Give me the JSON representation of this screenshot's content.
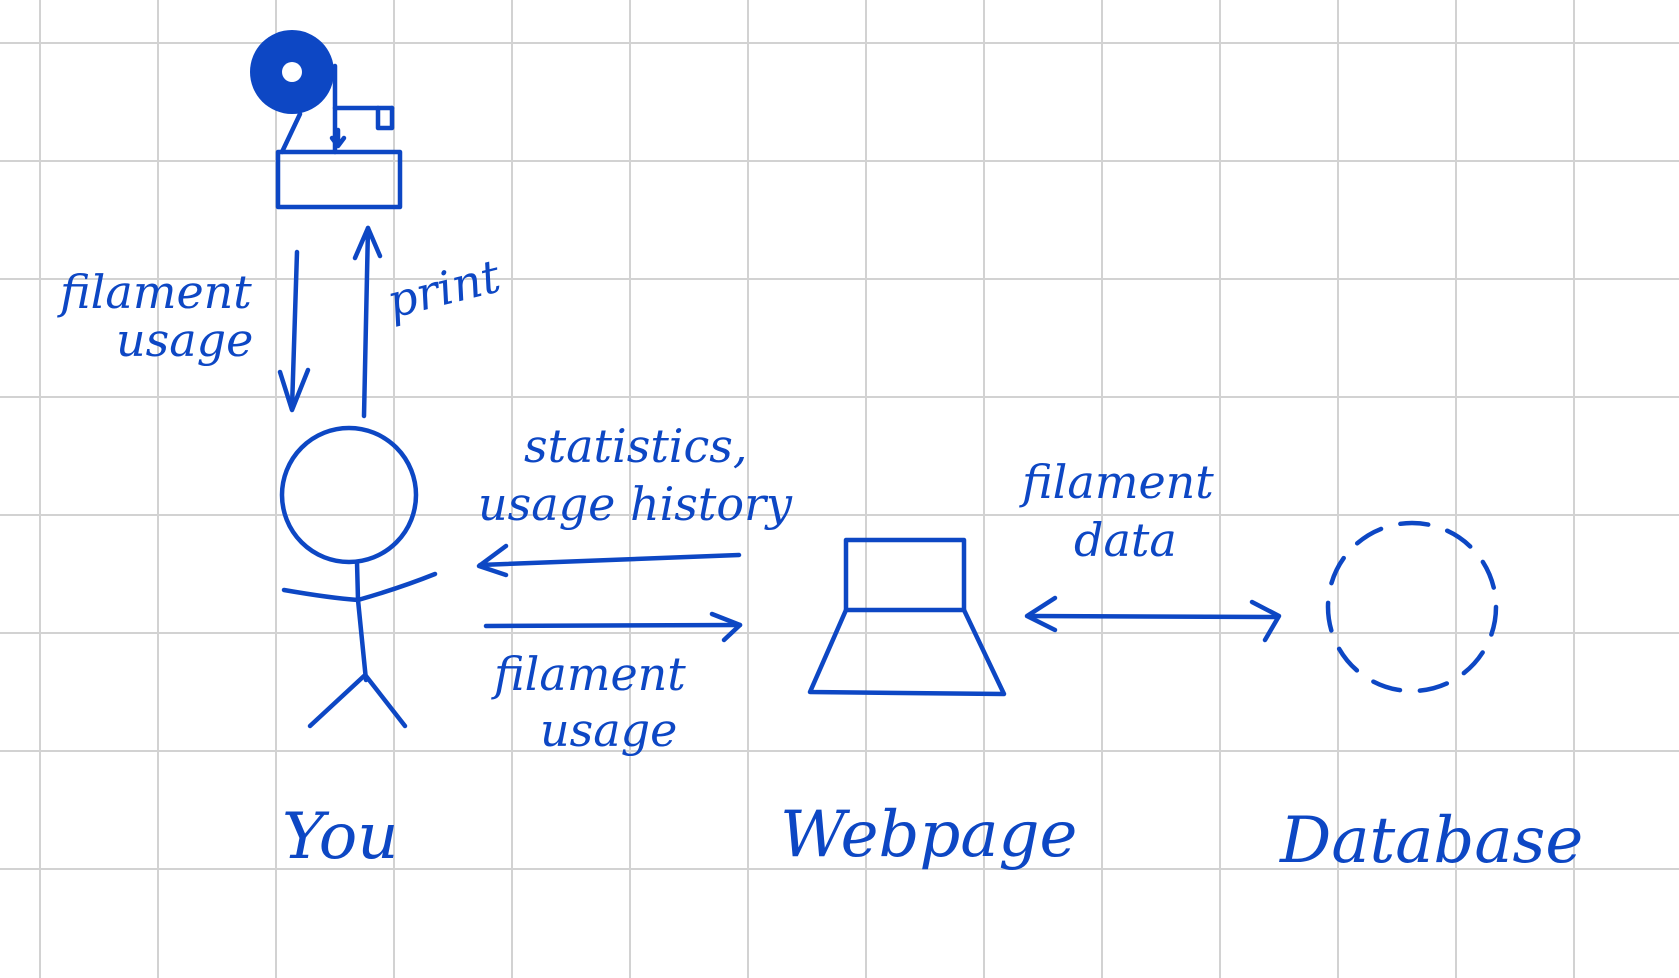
{
  "nodes": {
    "you": {
      "label": "You"
    },
    "webpage": {
      "label": "Webpage"
    },
    "database": {
      "label": "Database"
    }
  },
  "edges": {
    "filament_usage_to_you": {
      "line1": "filament",
      "line2": "usage"
    },
    "print": {
      "label": "print"
    },
    "statistics": {
      "line1": "statistics,",
      "line2": "usage history"
    },
    "filament_usage_to_webpage": {
      "line1": "filament",
      "line2": "usage"
    },
    "filament_data": {
      "line1": "filament",
      "line2": "data"
    }
  },
  "colors": {
    "ink": "#0d47c4",
    "grid": "#d2d2d2",
    "background": "#ffffff"
  },
  "icons": [
    "3d-printer-icon",
    "stick-figure-icon",
    "laptop-icon",
    "dashed-circle-database-icon"
  ]
}
